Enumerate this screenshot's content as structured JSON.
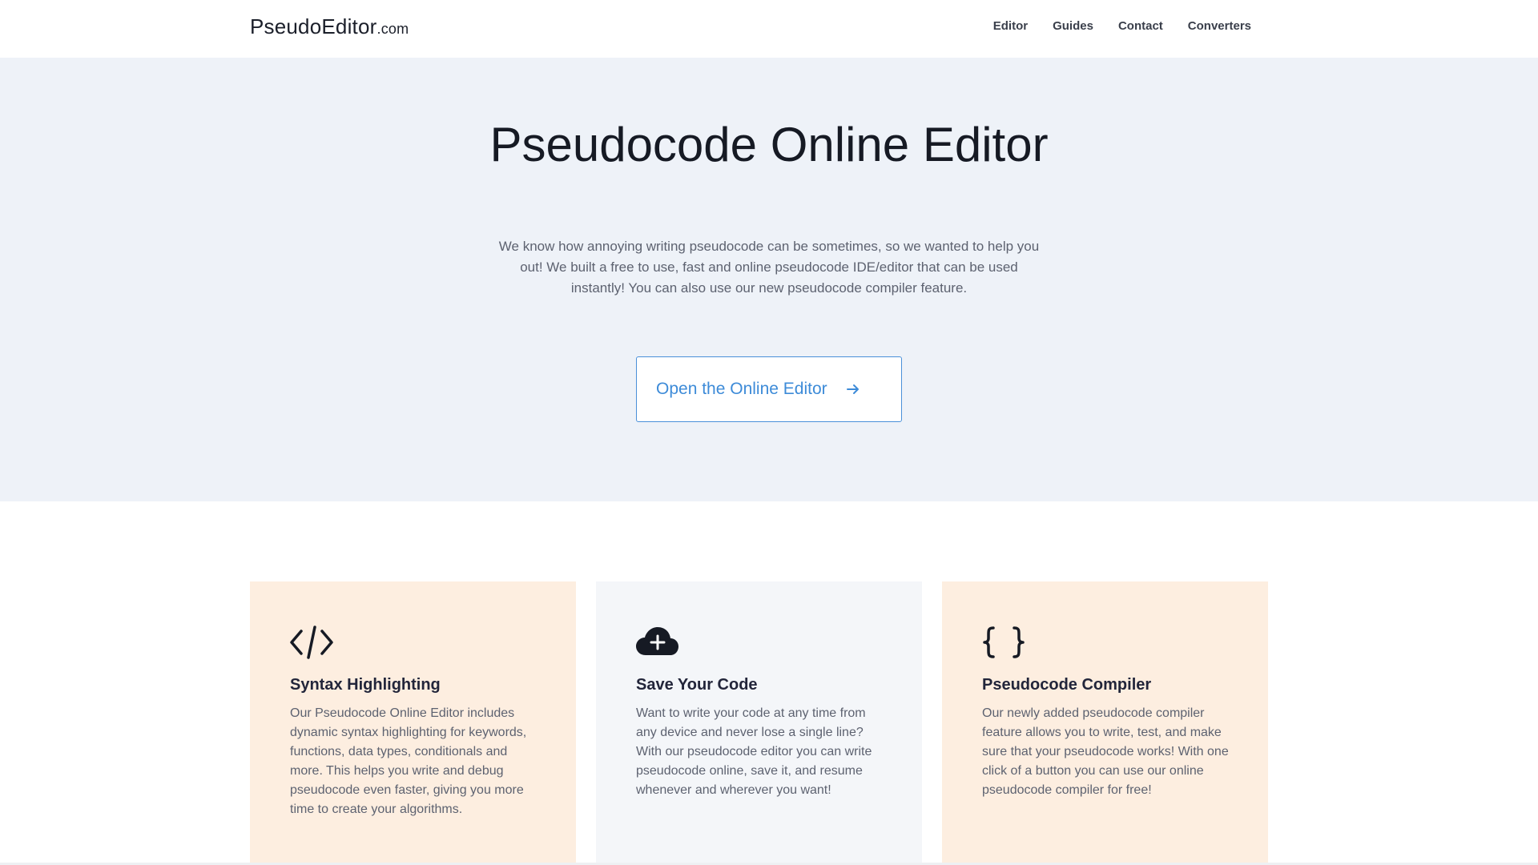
{
  "header": {
    "logo_main": "PseudoEditor",
    "logo_suffix": ".com",
    "nav": [
      "Editor",
      "Guides",
      "Contact",
      "Converters"
    ]
  },
  "hero": {
    "title": "Pseudocode Online Editor",
    "description": "We know how annoying writing pseudocode can be sometimes, so we wanted to help you out! We built a free to use, fast and online pseudocode IDE/editor that can be used instantly! You can also use our new pseudocode compiler feature.",
    "cta_label": "Open the Online Editor",
    "cta_icon": "arrow-right-icon"
  },
  "features": [
    {
      "icon": "code-brackets-icon",
      "title": "Syntax Highlighting",
      "text": "Our Pseudocode Online Editor includes dynamic syntax highlighting for keywords, functions, data types, conditionals and more. This helps you write and debug pseudocode even faster, giving you more time to create your algorithms."
    },
    {
      "icon": "cloud-plus-icon",
      "title": "Save Your Code",
      "text": "Want to write your code at any time from any device and never lose a single line? With our pseudocode editor you can write pseudocode online, save it, and resume whenever and wherever you want!"
    },
    {
      "icon": "curly-braces-icon",
      "title": "Pseudocode Compiler",
      "text": "Our newly added pseudocode compiler feature allows you to write, test, and make sure that your pseudocode works! With one click of a button you can use our online pseudocode compiler for free!"
    }
  ],
  "colors": {
    "accent": "#3d8bd8",
    "hero_bg": "#eef2f8",
    "card_warm": "#fdeee0",
    "card_cool": "#f4f6f9"
  }
}
